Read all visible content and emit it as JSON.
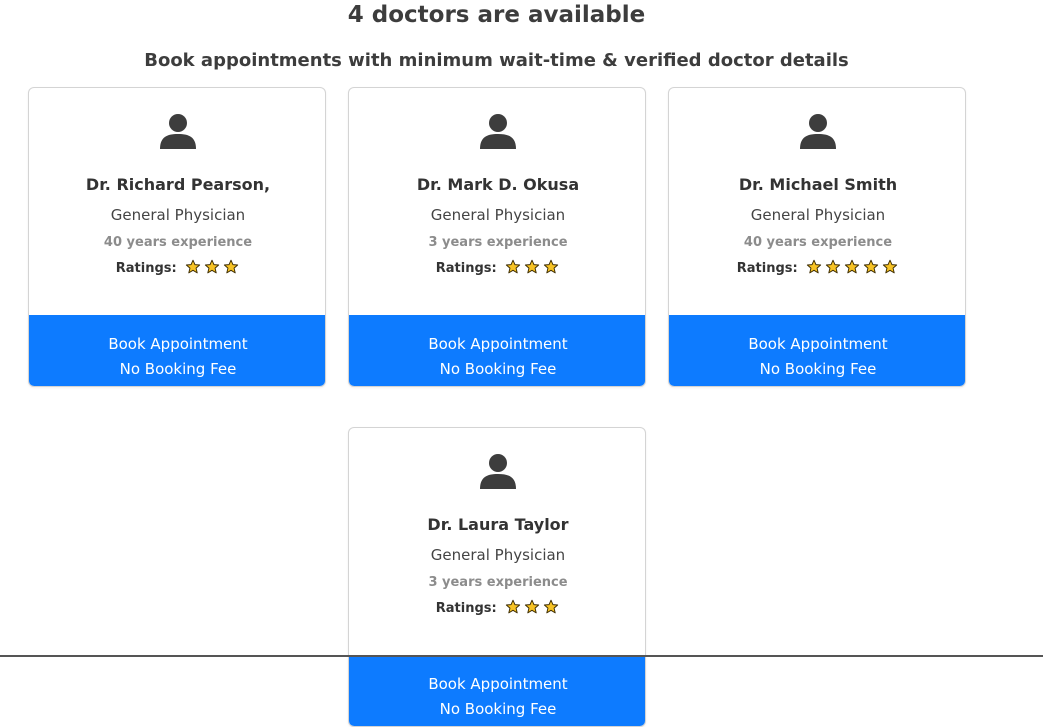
{
  "header": {
    "title": "4 doctors are available",
    "subtitle": "Book appointments with minimum wait-time & verified doctor details"
  },
  "doctors": [
    {
      "name": "Dr. Richard Pearson,",
      "specialty": "General Physician",
      "experience": "40 years experience",
      "ratings_label": "Ratings:",
      "stars": 3,
      "button_line1": "Book Appointment",
      "button_line2": "No Booking Fee"
    },
    {
      "name": "Dr. Mark D. Okusa",
      "specialty": "General Physician",
      "experience": "3 years experience",
      "ratings_label": "Ratings:",
      "stars": 3,
      "button_line1": "Book Appointment",
      "button_line2": "No Booking Fee"
    },
    {
      "name": "Dr. Michael Smith",
      "specialty": "General Physician",
      "experience": "40 years experience",
      "ratings_label": "Ratings:",
      "stars": 5,
      "button_line1": "Book Appointment",
      "button_line2": "No Booking Fee"
    },
    {
      "name": "Dr. Laura Taylor",
      "specialty": "General Physician",
      "experience": "3 years experience",
      "ratings_label": "Ratings:",
      "stars": 3,
      "button_line1": "Book Appointment",
      "button_line2": "No Booking Fee"
    }
  ],
  "colors": {
    "button_bg": "#0d7bff",
    "star_fill": "#f7c325",
    "avatar": "#3d3d3d"
  },
  "icons": {
    "avatar": "user-icon",
    "rating": "star-icon"
  }
}
